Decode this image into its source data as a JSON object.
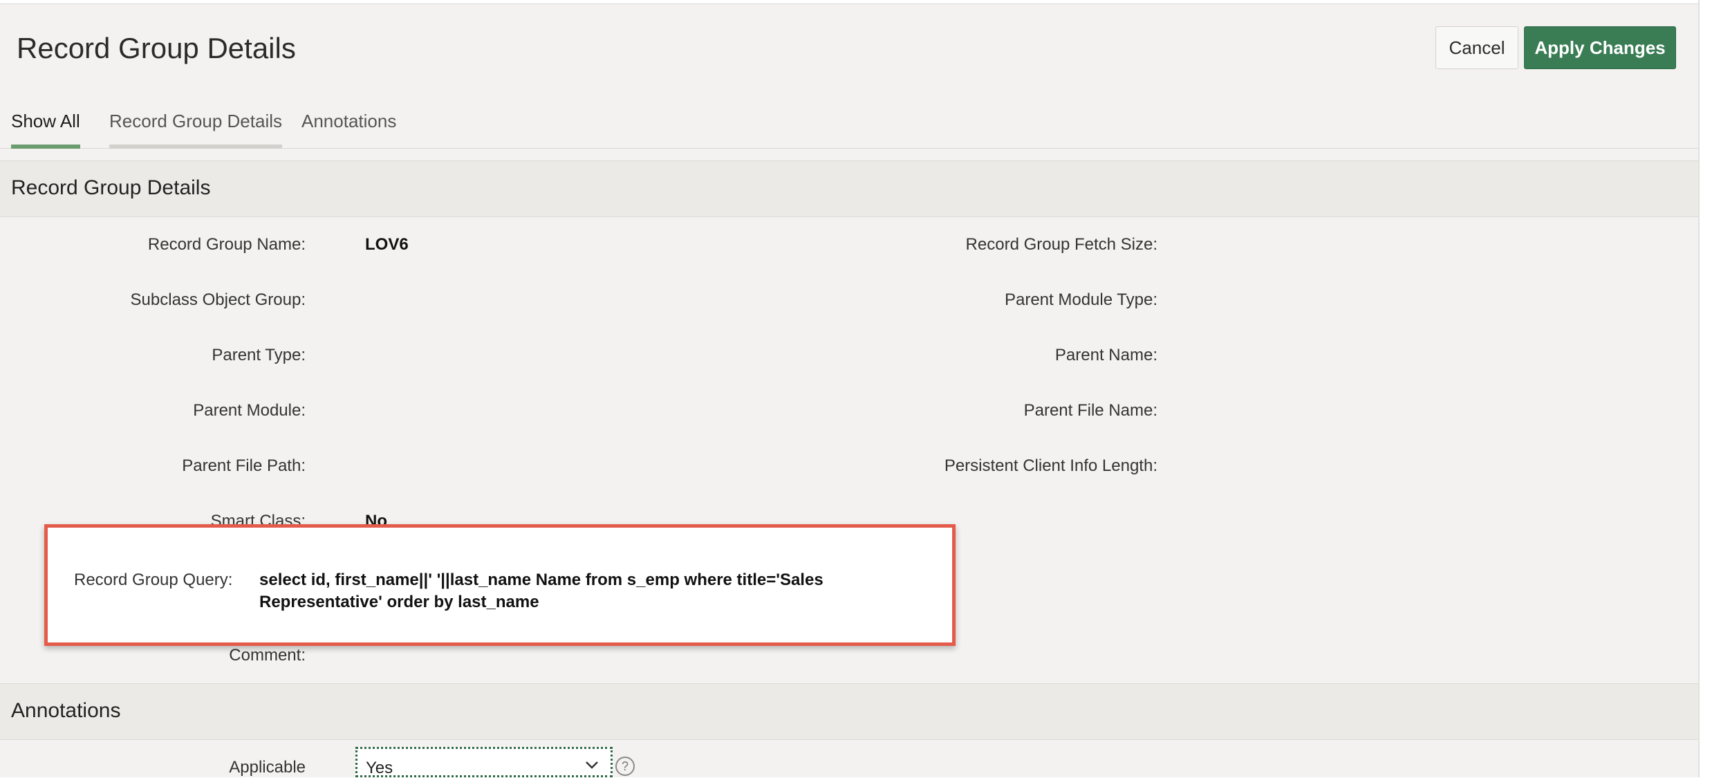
{
  "header": {
    "title": "Record Group Details",
    "cancel_label": "Cancel",
    "apply_label": "Apply Changes"
  },
  "tabs": [
    {
      "label": "Show All",
      "active": true
    },
    {
      "label": "Record Group Details",
      "active": false
    },
    {
      "label": "Annotations",
      "active": false
    }
  ],
  "section_details": {
    "title": "Record Group Details",
    "left_fields": [
      {
        "label": "Record Group Name:",
        "value": "LOV6"
      },
      {
        "label": "Subclass Object Group:",
        "value": ""
      },
      {
        "label": "Parent Type:",
        "value": ""
      },
      {
        "label": "Parent Module:",
        "value": ""
      },
      {
        "label": "Parent File Path:",
        "value": ""
      },
      {
        "label": "Smart Class:",
        "value": "No"
      },
      {
        "label": "Comment:",
        "value": ""
      }
    ],
    "right_fields": [
      {
        "label": "Record Group Fetch Size:",
        "value": ""
      },
      {
        "label": "Parent Module Type:",
        "value": ""
      },
      {
        "label": "Parent Name:",
        "value": ""
      },
      {
        "label": "Parent File Name:",
        "value": ""
      },
      {
        "label": "Persistent Client Info Length:",
        "value": ""
      }
    ],
    "query": {
      "label": "Record Group Query:",
      "value_line1": "select id, first_name||' '||last_name Name from s_emp where title='Sales",
      "value_line2": "Representative' order by last_name"
    }
  },
  "section_annotations": {
    "title": "Annotations",
    "applicable_label": "Applicable",
    "applicable_value": "Yes",
    "help_glyph": "?"
  },
  "colors": {
    "primary": "#3a7d55",
    "highlight_border": "#e45a4b",
    "tab_active_bar": "#6a9c6d"
  }
}
